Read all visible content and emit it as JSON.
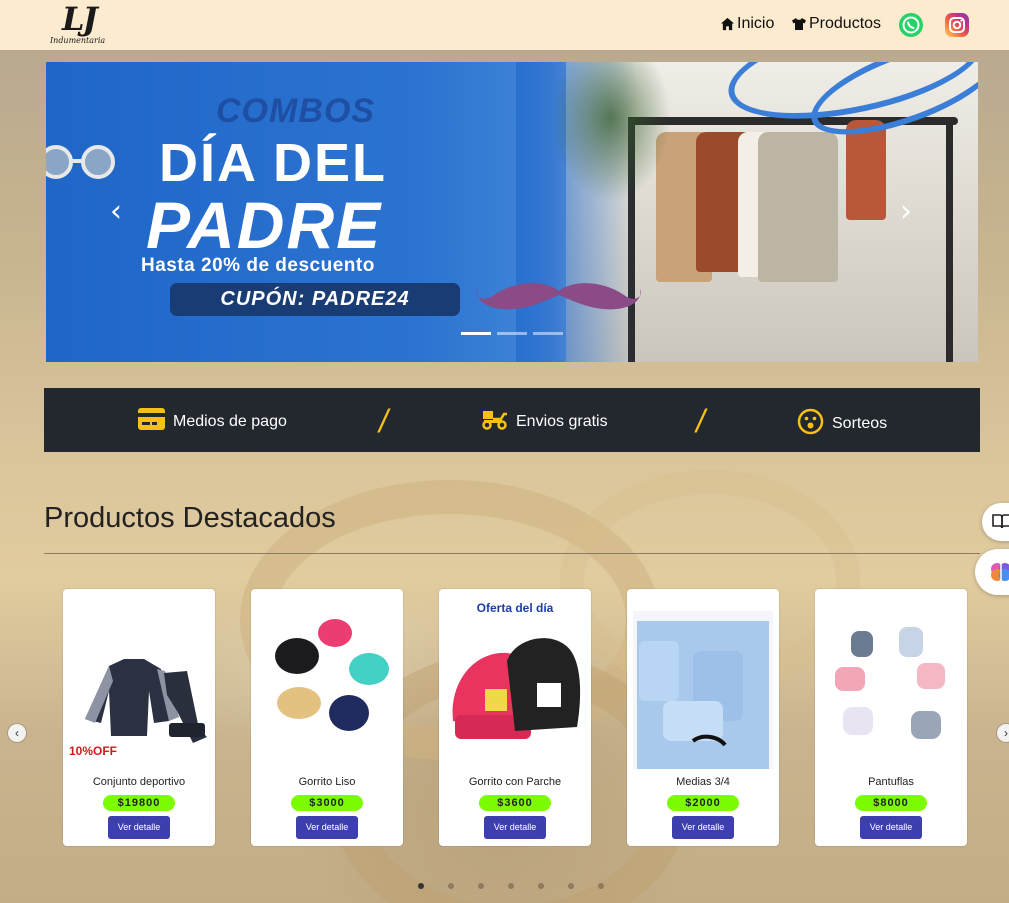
{
  "brand": {
    "logo_mark": "LJ",
    "logo_sub": "Indumentaria"
  },
  "nav": {
    "inicio": "Inicio",
    "productos": "Productos",
    "icons": [
      "home-icon",
      "shirt-icon",
      "whatsapp-icon",
      "instagram-icon"
    ]
  },
  "banner": {
    "line1": "COMBOS",
    "line2": "DÍA DEL",
    "line3": "PADRE",
    "line4": "Hasta 20% de descuento",
    "coupon": "CUPÓN: PADRE24",
    "prev_glyph": "‹",
    "next_glyph": "›",
    "slides": 3,
    "active_slide": 1
  },
  "info": {
    "payment": "Medios de pago",
    "shipping": "Envios gratis",
    "raffles": "Sorteos",
    "separator": "/"
  },
  "section": {
    "title": "Productos Destacados"
  },
  "products": [
    {
      "name": "Conjunto deportivo",
      "price": "$19800",
      "button": "Ver detalle",
      "discount": "10%OFF",
      "badge": ""
    },
    {
      "name": "Gorrito Liso",
      "price": "$3000",
      "button": "Ver detalle",
      "discount": "",
      "badge": ""
    },
    {
      "name": "Gorrito con Parche",
      "price": "$3600",
      "button": "Ver detalle",
      "discount": "",
      "badge": "Oferta del día"
    },
    {
      "name": "Medias 3/4",
      "price": "$2000",
      "button": "Ver detalle",
      "discount": "",
      "badge": ""
    },
    {
      "name": "Pantuflas",
      "price": "$8000",
      "button": "Ver detalle",
      "discount": "",
      "badge": ""
    }
  ],
  "products_carousel": {
    "pages": 7,
    "active_page": 1,
    "prev_glyph": "‹",
    "next_glyph": "›"
  },
  "colors": {
    "navbar": "#fdebd0",
    "info_strip": "#23272e",
    "accent_yellow": "#f5c118",
    "price_green": "#7cfc00",
    "button_blue": "#3d3fae",
    "discount_red": "#d11a1a",
    "offer_blue": "#1b3fa6"
  }
}
